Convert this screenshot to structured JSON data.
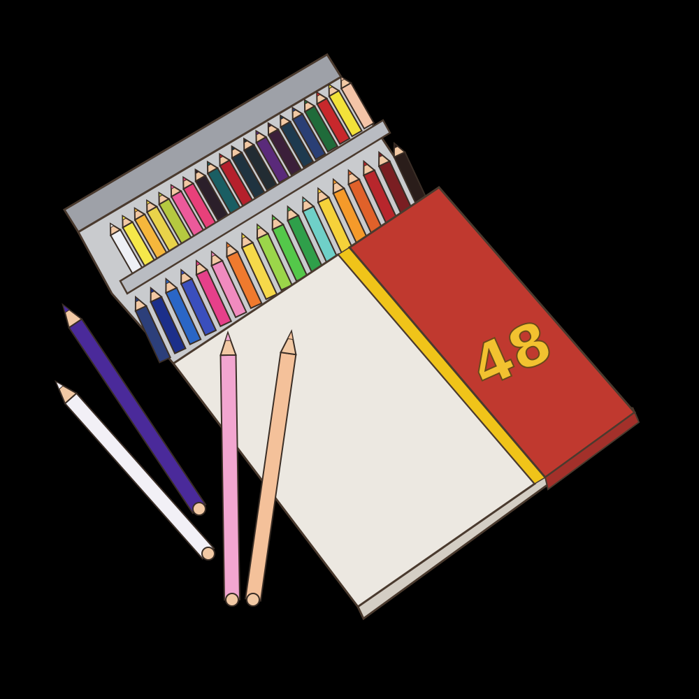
{
  "box": {
    "count_label": "48",
    "colors": {
      "tray": "#c9cbce",
      "tray_shadow": "#9ea1a8",
      "sleeve": "#ece8e1",
      "red_panel": "#c0392f",
      "stripe": "#f0c419",
      "label_text": "#f2c230",
      "outline": "#4a3a2e"
    }
  },
  "back_row_colors": [
    "#eef0f5",
    "#f5e84a",
    "#f6b73c",
    "#e9d34a",
    "#b5c940",
    "#ec5a9b",
    "#e8407a",
    "#2b1f2a",
    "#1a5e63",
    "#b5202c",
    "#1f3340",
    "#222c33",
    "#5a2a7a",
    "#3b1f3a",
    "#1e3a4f",
    "#2a3f75",
    "#1f6b3a",
    "#c8282c",
    "#f3e23a",
    "#f3c4a7"
  ],
  "front_row_colors": [
    "#2c3f7a",
    "#1c2f8a",
    "#2a66c6",
    "#3a4fbd",
    "#e6408a",
    "#f08bbf",
    "#ef7a2e",
    "#f6d94a",
    "#9bd64a",
    "#54c84a",
    "#2f9f4a",
    "#6fd0c8",
    "#f5d23a",
    "#f59a2a",
    "#e0612a",
    "#b8262c",
    "#7a1e22",
    "#2a1d1a"
  ],
  "loose_pencils": [
    {
      "name": "purple-pencil",
      "color": "#4a2a9a"
    },
    {
      "name": "white-pencil",
      "color": "#f2f0f6"
    },
    {
      "name": "pink-pencil",
      "color": "#f2a6d0"
    },
    {
      "name": "peach-pencil",
      "color": "#f4c19a"
    }
  ]
}
